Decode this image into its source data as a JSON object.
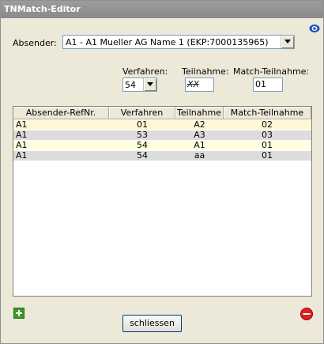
{
  "window": {
    "title": "TNMatch-Editor"
  },
  "icons": {
    "help": "help-eye-icon",
    "add": "add-icon",
    "remove": "remove-icon",
    "dropdown": "chevron-down-icon"
  },
  "absender": {
    "label": "Absender:",
    "value": "A1 - A1 Mueller AG Name 1 (EKP:7000135965)"
  },
  "filters": {
    "verfahren_label": "Verfahren:",
    "verfahren_value": "54",
    "teilnahme_label": "Teilnahme:",
    "teilnahme_value": "XX",
    "match_label": "Match-Teilnahme:",
    "match_value": "01"
  },
  "table": {
    "columns": [
      "Absender-RefNr.",
      "Verfahren",
      "Teilnahme",
      "Match-Teilnahme"
    ],
    "rows": [
      [
        "A1",
        "01",
        "A2",
        "02"
      ],
      [
        "A1",
        "53",
        "A3",
        "03"
      ],
      [
        "A1",
        "54",
        "A1",
        "01"
      ],
      [
        "A1",
        "54",
        "aa",
        "01"
      ]
    ]
  },
  "buttons": {
    "close_label": "schliessen"
  }
}
